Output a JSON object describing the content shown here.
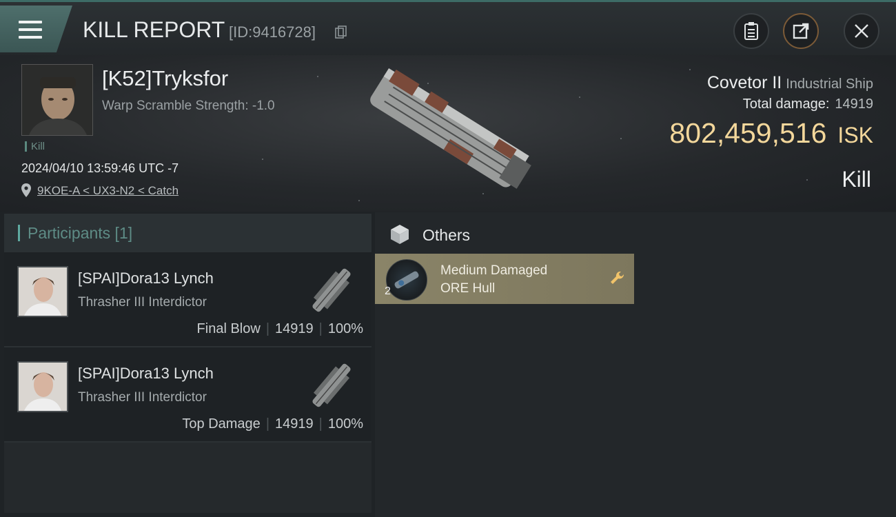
{
  "header": {
    "title": "KILL REPORT",
    "report_id": "[ID:9416728]",
    "buttons": {
      "clipboard": "clipboard-icon",
      "share": "share-icon",
      "close": "close-icon"
    }
  },
  "victim": {
    "name": "[K52]Tryksfor",
    "warp_scramble": "Warp Scramble Strength: -1.0",
    "tag": "Kill",
    "datetime": "2024/04/10 13:59:46 UTC -7",
    "location": "9KOE-A < UX3-N2 < Catch"
  },
  "ship": {
    "name": "Covetor II",
    "class": "Industrial Ship",
    "total_damage_label": "Total damage:",
    "total_damage": "14919",
    "isk_value": "802,459,516",
    "isk_unit": "ISK",
    "result": "Kill"
  },
  "participants": {
    "header": "Participants [1]",
    "items": [
      {
        "name": "[SPAI]Dora13 Lynch",
        "ship": "Thrasher III Interdictor",
        "role": "Final Blow",
        "damage": "14919",
        "percent": "100%"
      },
      {
        "name": "[SPAI]Dora13 Lynch",
        "ship": "Thrasher III Interdictor",
        "role": "Top Damage",
        "damage": "14919",
        "percent": "100%"
      }
    ]
  },
  "others": {
    "header": "Others",
    "items": [
      {
        "name_line1": "Medium Damaged",
        "name_line2": "ORE Hull",
        "quantity": "2"
      }
    ]
  },
  "colors": {
    "accent": "#5fa9a0",
    "isk": "#f3d79b",
    "item_card": "#8a8468"
  }
}
